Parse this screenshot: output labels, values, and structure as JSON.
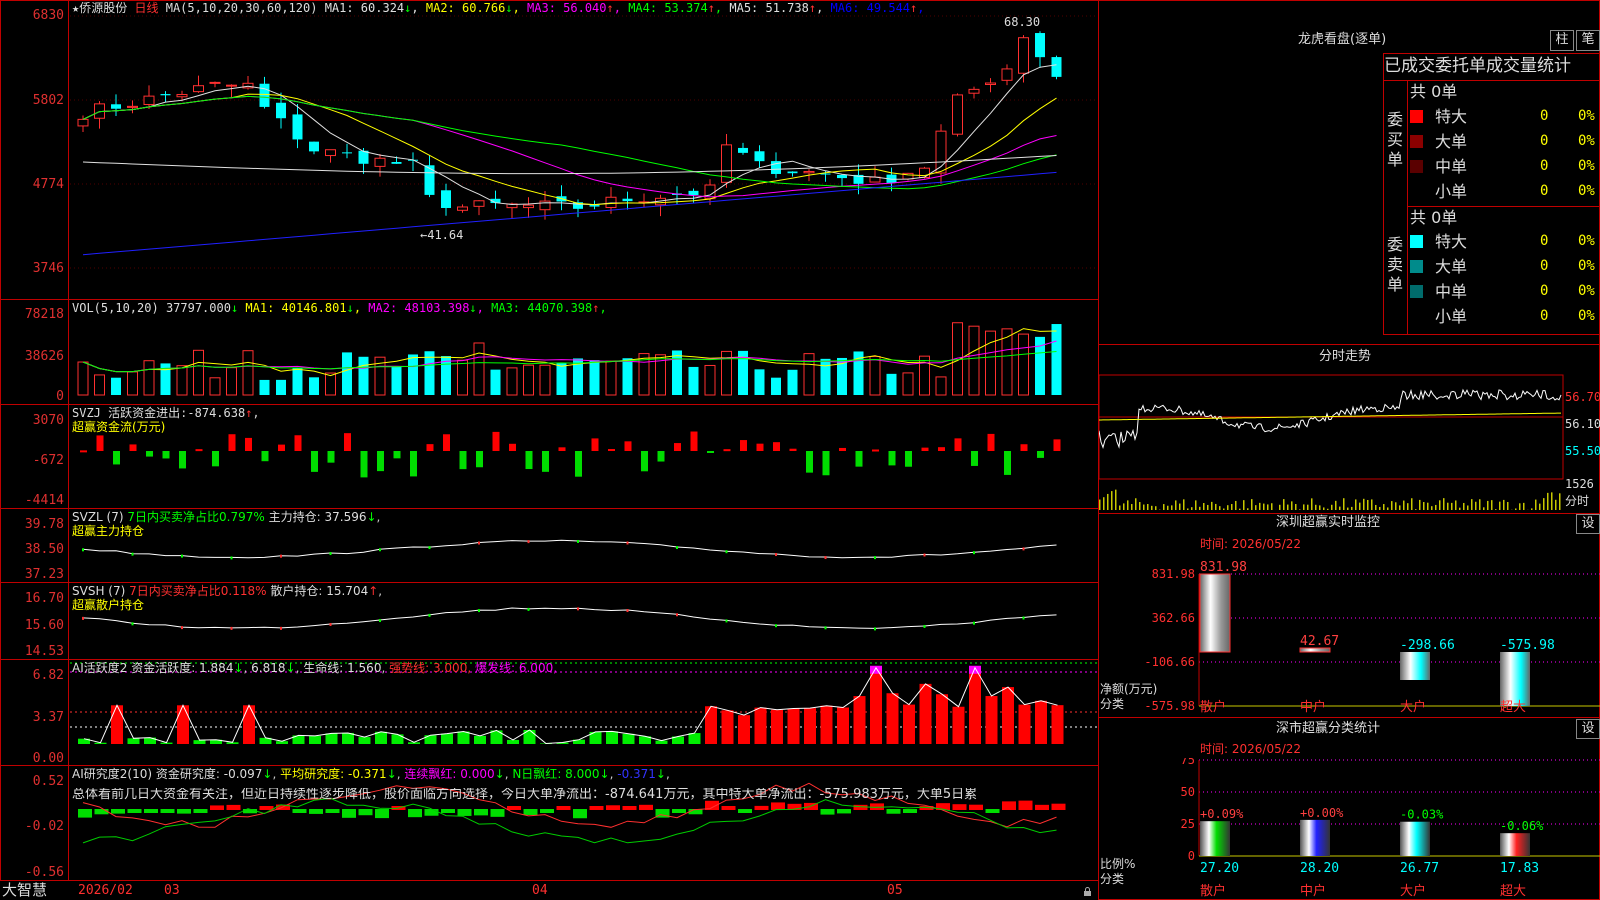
{
  "app": {
    "brand": "大智慧"
  },
  "main_chart": {
    "star": "★",
    "stock_name": "侨源股份",
    "period": "日线",
    "ma_label": "MA(5,10,20,30,60,120)",
    "ma": [
      {
        "name": "MA1",
        "value": "60.324",
        "dir": "↓",
        "color": "#e0e0e0"
      },
      {
        "name": "MA2",
        "value": "60.766",
        "dir": "↓",
        "color": "#ffff00"
      },
      {
        "name": "MA3",
        "value": "56.040",
        "dir": "↑",
        "color": "#ff00ff"
      },
      {
        "name": "MA4",
        "value": "53.374",
        "dir": "↑",
        "color": "#00ff00"
      },
      {
        "name": "MA5",
        "value": "51.738",
        "dir": "↑",
        "color": "#e0e0e0"
      },
      {
        "name": "MA6",
        "value": "49.544",
        "dir": "↑",
        "color": "#0000ff"
      }
    ],
    "y_ticks": [
      "6830",
      "5802",
      "4774",
      "3746"
    ],
    "high_mark": "68.30",
    "low_mark": "41.64",
    "x_labels": [
      "2026/02",
      "03",
      "04",
      "05"
    ]
  },
  "vol": {
    "label": "VOL(5,10,20)",
    "value": "37797.000",
    "dir": "↓",
    "ma": [
      {
        "name": "MA1",
        "value": "40146.801",
        "dir": "↓",
        "color": "#ffff00"
      },
      {
        "name": "MA2",
        "value": "48103.398",
        "dir": "↓",
        "color": "#ff00ff"
      },
      {
        "name": "MA3",
        "value": "44070.398",
        "dir": "↑",
        "color": "#00ff00"
      }
    ],
    "y_ticks": [
      "78218",
      "38626",
      "0"
    ]
  },
  "svzj": {
    "label": "SVZJ",
    "title": "活跃资金进出",
    "value": "-874.638",
    "dir": "↑",
    "subtitle": "超赢资金流(万元)",
    "y_ticks": [
      "3070",
      "-672",
      "-4414"
    ]
  },
  "svzl": {
    "label": "SVZL (7)",
    "text1": "7日内买卖净占比0.797%",
    "text2": "主力持仓",
    "value": "37.596",
    "dir": "↓",
    "subtitle": "超赢主力持仓",
    "y_ticks": [
      "39.78",
      "38.50",
      "37.23"
    ]
  },
  "svsh": {
    "label": "SVSH (7)",
    "text1": "7日内买卖净占比0.118%",
    "text2": "散户持仓",
    "value": "15.704",
    "dir": "↑",
    "subtitle": "超赢散户持仓",
    "y_ticks": [
      "16.70",
      "15.60",
      "14.53"
    ]
  },
  "ai_act": {
    "label": "AI活跃度2",
    "t1": "资金活跃度",
    "v1": "1.884",
    "d1": "↓",
    "v2": "6.818",
    "d2": "↓",
    "t3": "生命线",
    "v3": "1.560",
    "t4": "强势线",
    "v4": "3.000",
    "t5": "爆发线",
    "v5": "6.000",
    "y_ticks": [
      "6.82",
      "3.37",
      "0.00"
    ]
  },
  "ai_res": {
    "label": "AI研究度2(10)",
    "t1": "资金研究度",
    "v1": "-0.097",
    "d1": "↓",
    "t2": "平均研究度",
    "v2": "-0.371",
    "d2": "↓",
    "t3": "连续飘红",
    "v3": "0.000",
    "d3": "↓",
    "t4": "N日飘红",
    "v4": "8.000",
    "d4": "↓",
    "v5": "-0.371",
    "d5": "↓",
    "summary": "总体看前几日大资金有关注，但近日持续性逐步降低，股价面临方向选择，今日大单净流出：-874.641万元，其中特大单净流出：-575.983万元，大单5日累",
    "y_ticks": [
      "0.52",
      "-0.02",
      "-0.56"
    ]
  },
  "dragon": {
    "title": "龙虎看盘(逐单)",
    "btn_zhu": "柱",
    "btn_bi": "笔",
    "tabs": [
      "已成交",
      "委托单",
      "成交量统计"
    ],
    "buy": {
      "side": "委买单",
      "total": "共 0单",
      "rows": [
        {
          "name": "特大",
          "value": "0",
          "pct": "0%",
          "color": "#ff0000"
        },
        {
          "name": "大单",
          "value": "0",
          "pct": "0%",
          "color": "#8b0000"
        },
        {
          "name": "中单",
          "value": "0",
          "pct": "0%",
          "color": "#5a0000"
        },
        {
          "name": "小单",
          "value": "0",
          "pct": "0%",
          "color": "#000000"
        }
      ]
    },
    "sell": {
      "side": "委卖单",
      "total": "共 0单",
      "rows": [
        {
          "name": "特大",
          "value": "0",
          "pct": "0%",
          "color": "#00ffff"
        },
        {
          "name": "大单",
          "value": "0",
          "pct": "0%",
          "color": "#008b8b"
        },
        {
          "name": "中单",
          "value": "0",
          "pct": "0%",
          "color": "#006b6b"
        },
        {
          "name": "小单",
          "value": "0",
          "pct": "0%",
          "color": "#000000"
        }
      ]
    }
  },
  "intraday": {
    "title": "分时走势",
    "y_ticks": [
      "56.70",
      "56.10",
      "55.50"
    ],
    "vol_label": "1526",
    "vol_unit": "分时"
  },
  "sz_monitor": {
    "title": "深圳超赢实时监控",
    "settings": "设",
    "time": "时间: 2026/05/22",
    "y_ticks": [
      "831.98",
      "362.66",
      "-106.66",
      "-575.98"
    ],
    "y_title": "净额(万元)",
    "x_title": "分类",
    "chart_data": {
      "type": "bar",
      "categories": [
        "散户",
        "中户",
        "大户",
        "超大"
      ],
      "values": [
        831.98,
        42.67,
        -298.66,
        -575.98
      ],
      "ylim": [
        -575.98,
        831.98
      ],
      "labels": [
        "831.98",
        "42.67",
        "-298.66",
        "-575.98"
      ],
      "label_colors": [
        "#ff4040",
        "#ff4040",
        "#00ffff",
        "#00ffff"
      ]
    }
  },
  "sz_class": {
    "title": "深市超赢分类统计",
    "settings": "设",
    "time": "时间: 2026/05/22",
    "y_ticks": [
      "75",
      "50",
      "25",
      "0"
    ],
    "y_title": "比例%",
    "x_title": "分类",
    "chart_data": {
      "type": "bar",
      "categories": [
        "散户",
        "中户",
        "大户",
        "超大"
      ],
      "values": [
        27.2,
        28.2,
        26.77,
        17.83
      ],
      "ylim": [
        0,
        75
      ],
      "labels": [
        "27.20",
        "28.20",
        "26.77",
        "17.83"
      ],
      "changes": [
        "+0.09%",
        "+0.00%",
        "-0.03%",
        "-0.06%"
      ],
      "colors": [
        "#00dd00",
        "#2020ff",
        "#00ffff",
        "#ff2020"
      ],
      "change_colors": [
        "#ff4040",
        "#ff4040",
        "#00ff00",
        "#00ff00"
      ]
    }
  }
}
